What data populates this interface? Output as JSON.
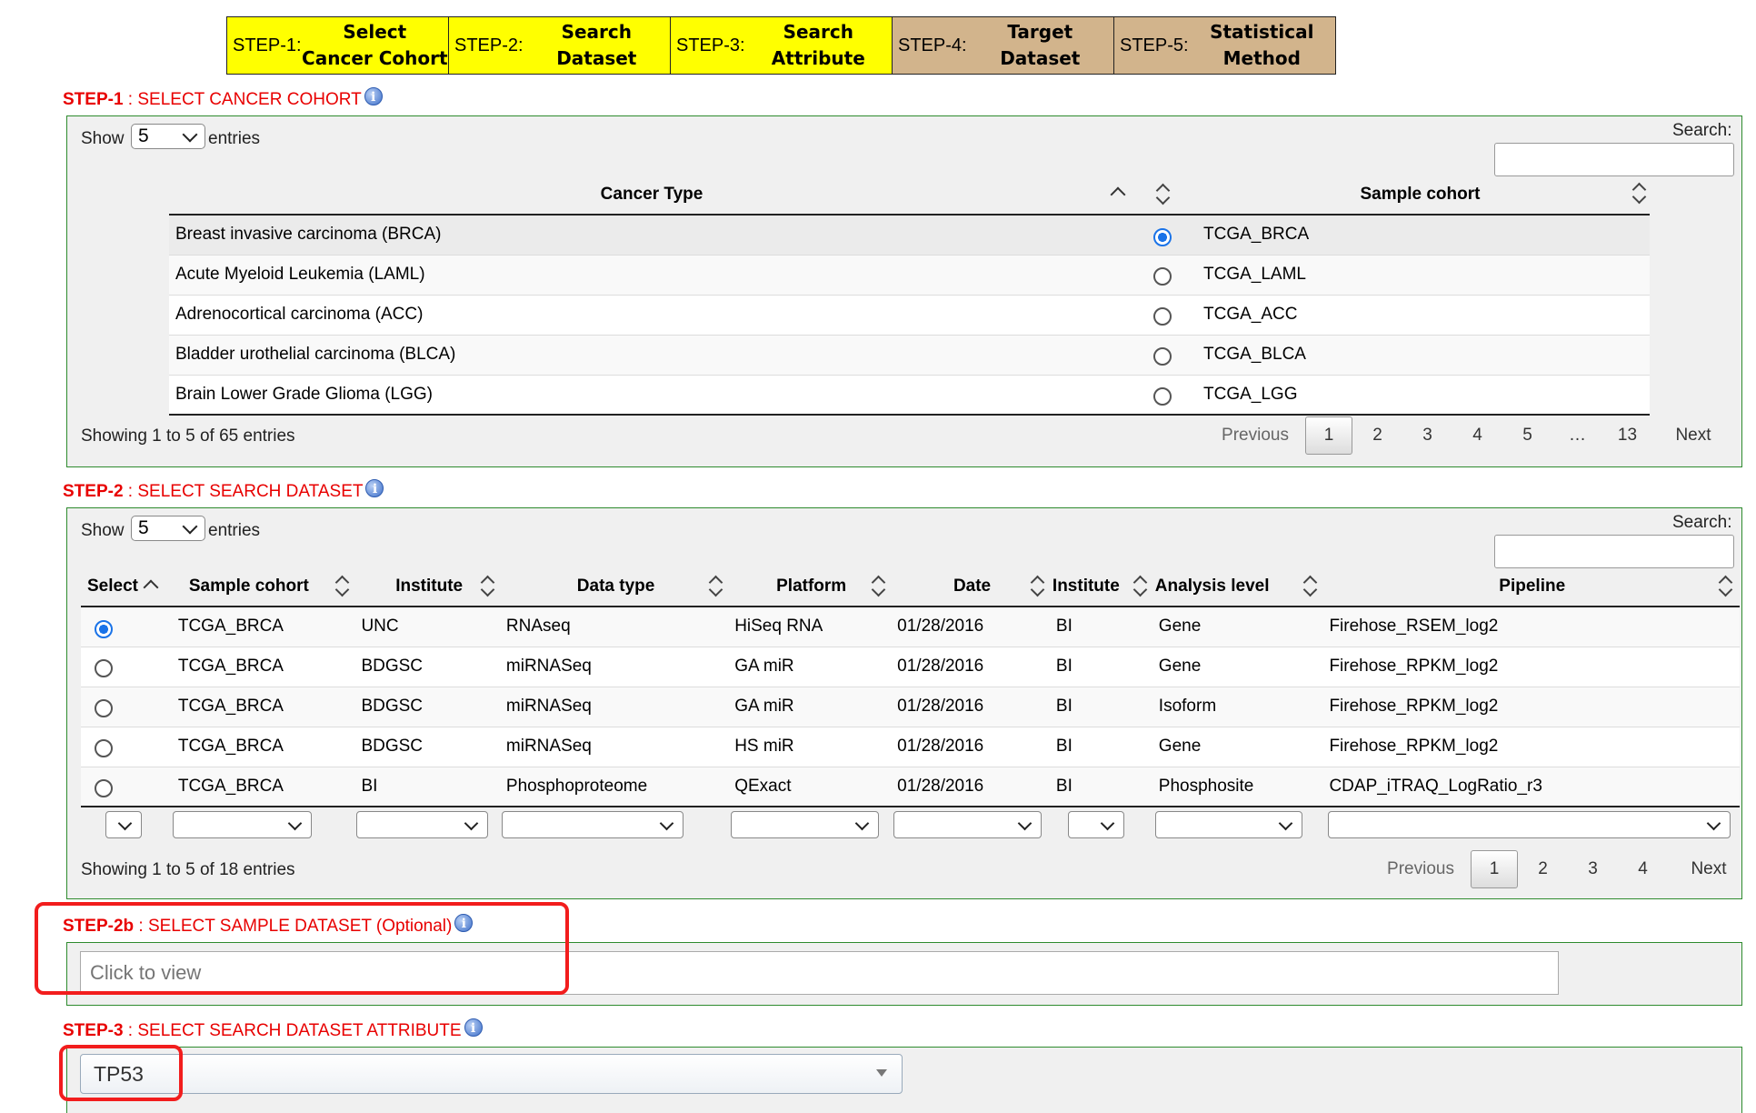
{
  "steps": [
    {
      "prefix": "STEP-1:",
      "name": "Select\nCancer Cohort",
      "color": "yellow"
    },
    {
      "prefix": "STEP-2:",
      "name": "Search\nDataset",
      "color": "yellow"
    },
    {
      "prefix": "STEP-3:",
      "name": "Search\nAttribute",
      "color": "yellow"
    },
    {
      "prefix": "STEP-4:",
      "name": "Target\nDataset",
      "color": "tan"
    },
    {
      "prefix": "STEP-5:",
      "name": "Statistical\nMethod",
      "color": "tan"
    }
  ],
  "step1": {
    "heading_bold": "STEP-1",
    "heading_text": " : SELECT CANCER COHORT",
    "show_label": "Show",
    "entries_value": "5",
    "entries_label": "entries",
    "search_label": "Search:",
    "columns": [
      "Cancer Type",
      "Sample cohort"
    ],
    "rows": [
      {
        "type": "Breast invasive carcinoma (BRCA)",
        "cohort": "TCGA_BRCA",
        "selected": true
      },
      {
        "type": "Acute Myeloid Leukemia (LAML)",
        "cohort": "TCGA_LAML",
        "selected": false
      },
      {
        "type": "Adrenocortical carcinoma (ACC)",
        "cohort": "TCGA_ACC",
        "selected": false
      },
      {
        "type": "Bladder urothelial carcinoma (BLCA)",
        "cohort": "TCGA_BLCA",
        "selected": false
      },
      {
        "type": "Brain Lower Grade Glioma (LGG)",
        "cohort": "TCGA_LGG",
        "selected": false
      }
    ],
    "info": "Showing 1 to 5 of 65 entries",
    "pager": {
      "previous": "Previous",
      "pages": [
        "1",
        "2",
        "3",
        "4",
        "5",
        "…",
        "13"
      ],
      "next": "Next"
    }
  },
  "step2": {
    "heading_bold": "STEP-2",
    "heading_text": " : SELECT SEARCH DATASET",
    "show_label": "Show",
    "entries_value": "5",
    "entries_label": "entries",
    "search_label": "Search:",
    "columns": [
      "Select",
      "Sample cohort",
      "Institute",
      "Data type",
      "Platform",
      "Date",
      "Institute",
      "Analysis level",
      "Pipeline"
    ],
    "rows": [
      {
        "selected": true,
        "cohort": "TCGA_BRCA",
        "institute": "UNC",
        "data_type": "RNAseq",
        "platform": "HiSeq RNA",
        "date": "01/28/2016",
        "inst2": "BI",
        "level": "Gene",
        "pipeline": "Firehose_RSEM_log2"
      },
      {
        "selected": false,
        "cohort": "TCGA_BRCA",
        "institute": "BDGSC",
        "data_type": "miRNASeq",
        "platform": "GA miR",
        "date": "01/28/2016",
        "inst2": "BI",
        "level": "Gene",
        "pipeline": "Firehose_RPKM_log2"
      },
      {
        "selected": false,
        "cohort": "TCGA_BRCA",
        "institute": "BDGSC",
        "data_type": "miRNASeq",
        "platform": "GA miR",
        "date": "01/28/2016",
        "inst2": "BI",
        "level": "Isoform",
        "pipeline": "Firehose_RPKM_log2"
      },
      {
        "selected": false,
        "cohort": "TCGA_BRCA",
        "institute": "BDGSC",
        "data_type": "miRNASeq",
        "platform": "HS miR",
        "date": "01/28/2016",
        "inst2": "BI",
        "level": "Gene",
        "pipeline": "Firehose_RPKM_log2"
      },
      {
        "selected": false,
        "cohort": "TCGA_BRCA",
        "institute": "BI",
        "data_type": "Phosphoproteome",
        "platform": "QExact",
        "date": "01/28/2016",
        "inst2": "BI",
        "level": "Phosphosite",
        "pipeline": "CDAP_iTRAQ_LogRatio_r3"
      }
    ],
    "info": "Showing 1 to 5 of 18 entries",
    "pager": {
      "previous": "Previous",
      "pages": [
        "1",
        "2",
        "3",
        "4"
      ],
      "next": "Next"
    }
  },
  "step2b": {
    "heading_bold": "STEP-2b",
    "heading_text": " : SELECT SAMPLE DATASET (Optional)",
    "placeholder": "Click to view"
  },
  "step3": {
    "heading_bold": "STEP-3",
    "heading_text": " : SELECT SEARCH DATASET ATTRIBUTE",
    "value": "TP53"
  },
  "info_icon": "i",
  "colors": {
    "heading": "#e80000",
    "panel_border": "#2e8b2e",
    "highlight": "#f21d1d",
    "yellow": "#ffff00",
    "tan": "#d2b48c"
  }
}
